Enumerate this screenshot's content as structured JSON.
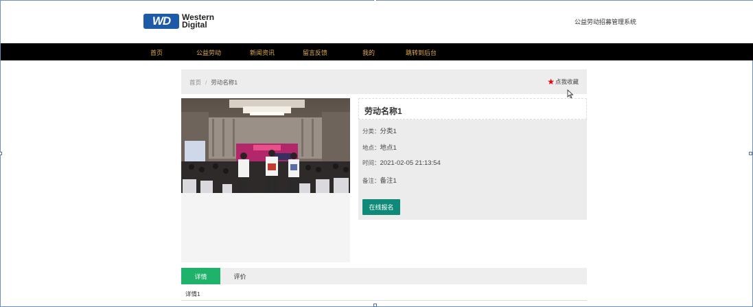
{
  "header": {
    "logo_badge": "WD",
    "logo_line1": "Western",
    "logo_line2": "Digital",
    "site_title": "公益劳动招募管理系统"
  },
  "nav": {
    "items": [
      {
        "label": "首页"
      },
      {
        "label": "公益劳动"
      },
      {
        "label": "新闻资讯"
      },
      {
        "label": "留言反馈"
      },
      {
        "label": "我的"
      },
      {
        "label": "跳转到后台"
      }
    ]
  },
  "breadcrumb": {
    "home": "首页",
    "separator": "/",
    "current": "劳动名称1"
  },
  "favorite": {
    "label": "点我收藏",
    "icon": "star-icon",
    "color": "#e00000"
  },
  "detail": {
    "title": "劳动名称1",
    "category_label": "分类：",
    "category_value": "分类1",
    "location_label": "地点：",
    "location_value": "地点1",
    "time_label": "时间：",
    "time_value": "2021-02-05 21:13:54",
    "remark_label": "备注：",
    "remark_value": "备注1",
    "signup_button": "在线报名"
  },
  "tabs": {
    "items": [
      {
        "label": "详情",
        "active": true
      },
      {
        "label": "评价",
        "active": false
      }
    ],
    "content": "详情1"
  },
  "colors": {
    "nav_bg": "#000000",
    "nav_text": "#e2b04a",
    "signup_bg": "#0f8a78",
    "tab_active": "#1fb26a"
  }
}
